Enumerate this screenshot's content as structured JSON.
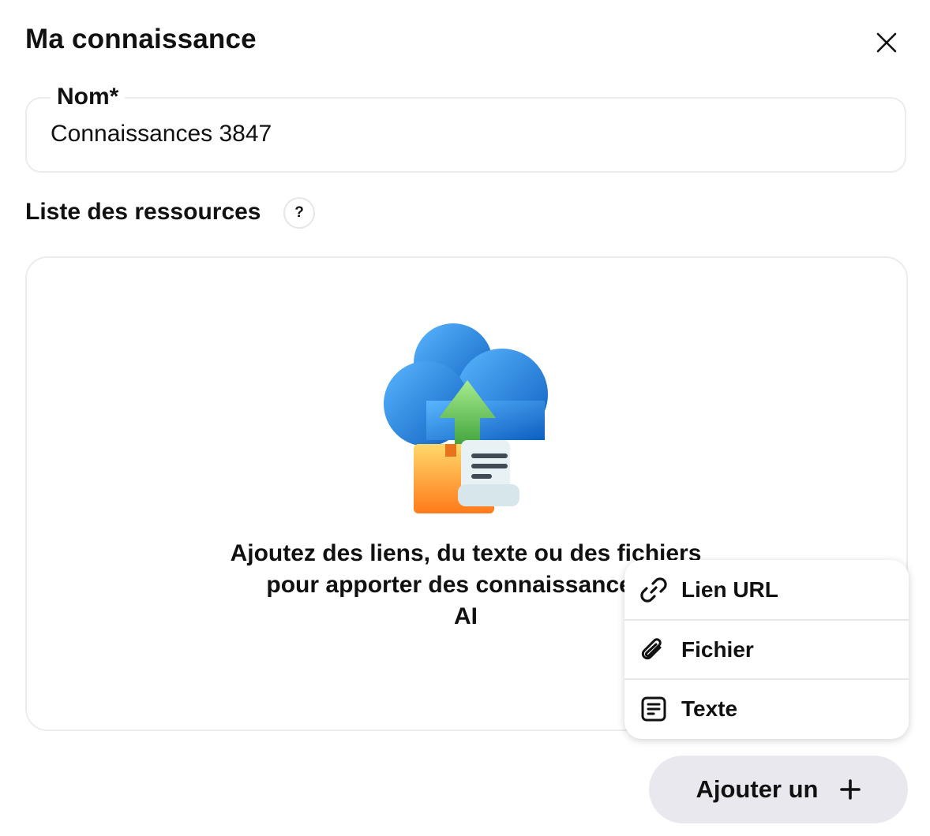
{
  "dialog": {
    "title": "Ma connaissance",
    "close_icon": "close-icon"
  },
  "name_field": {
    "label": "Nom*",
    "value": "Connaissances 3847"
  },
  "resources": {
    "label": "Liste des ressources",
    "help": "?",
    "empty_line1": "Ajoutez des liens, du texte ou des fichiers",
    "empty_line2": "pour apporter des connaissances à",
    "empty_line3": "AI",
    "illustration": "cloud-upload-document-icon"
  },
  "add_menu": {
    "items": [
      {
        "label": "Lien URL",
        "icon": "link-icon"
      },
      {
        "label": "Fichier",
        "icon": "paperclip-icon"
      },
      {
        "label": "Texte",
        "icon": "text-document-icon"
      }
    ]
  },
  "add_button": {
    "label": "Ajouter un",
    "icon": "plus-icon"
  }
}
